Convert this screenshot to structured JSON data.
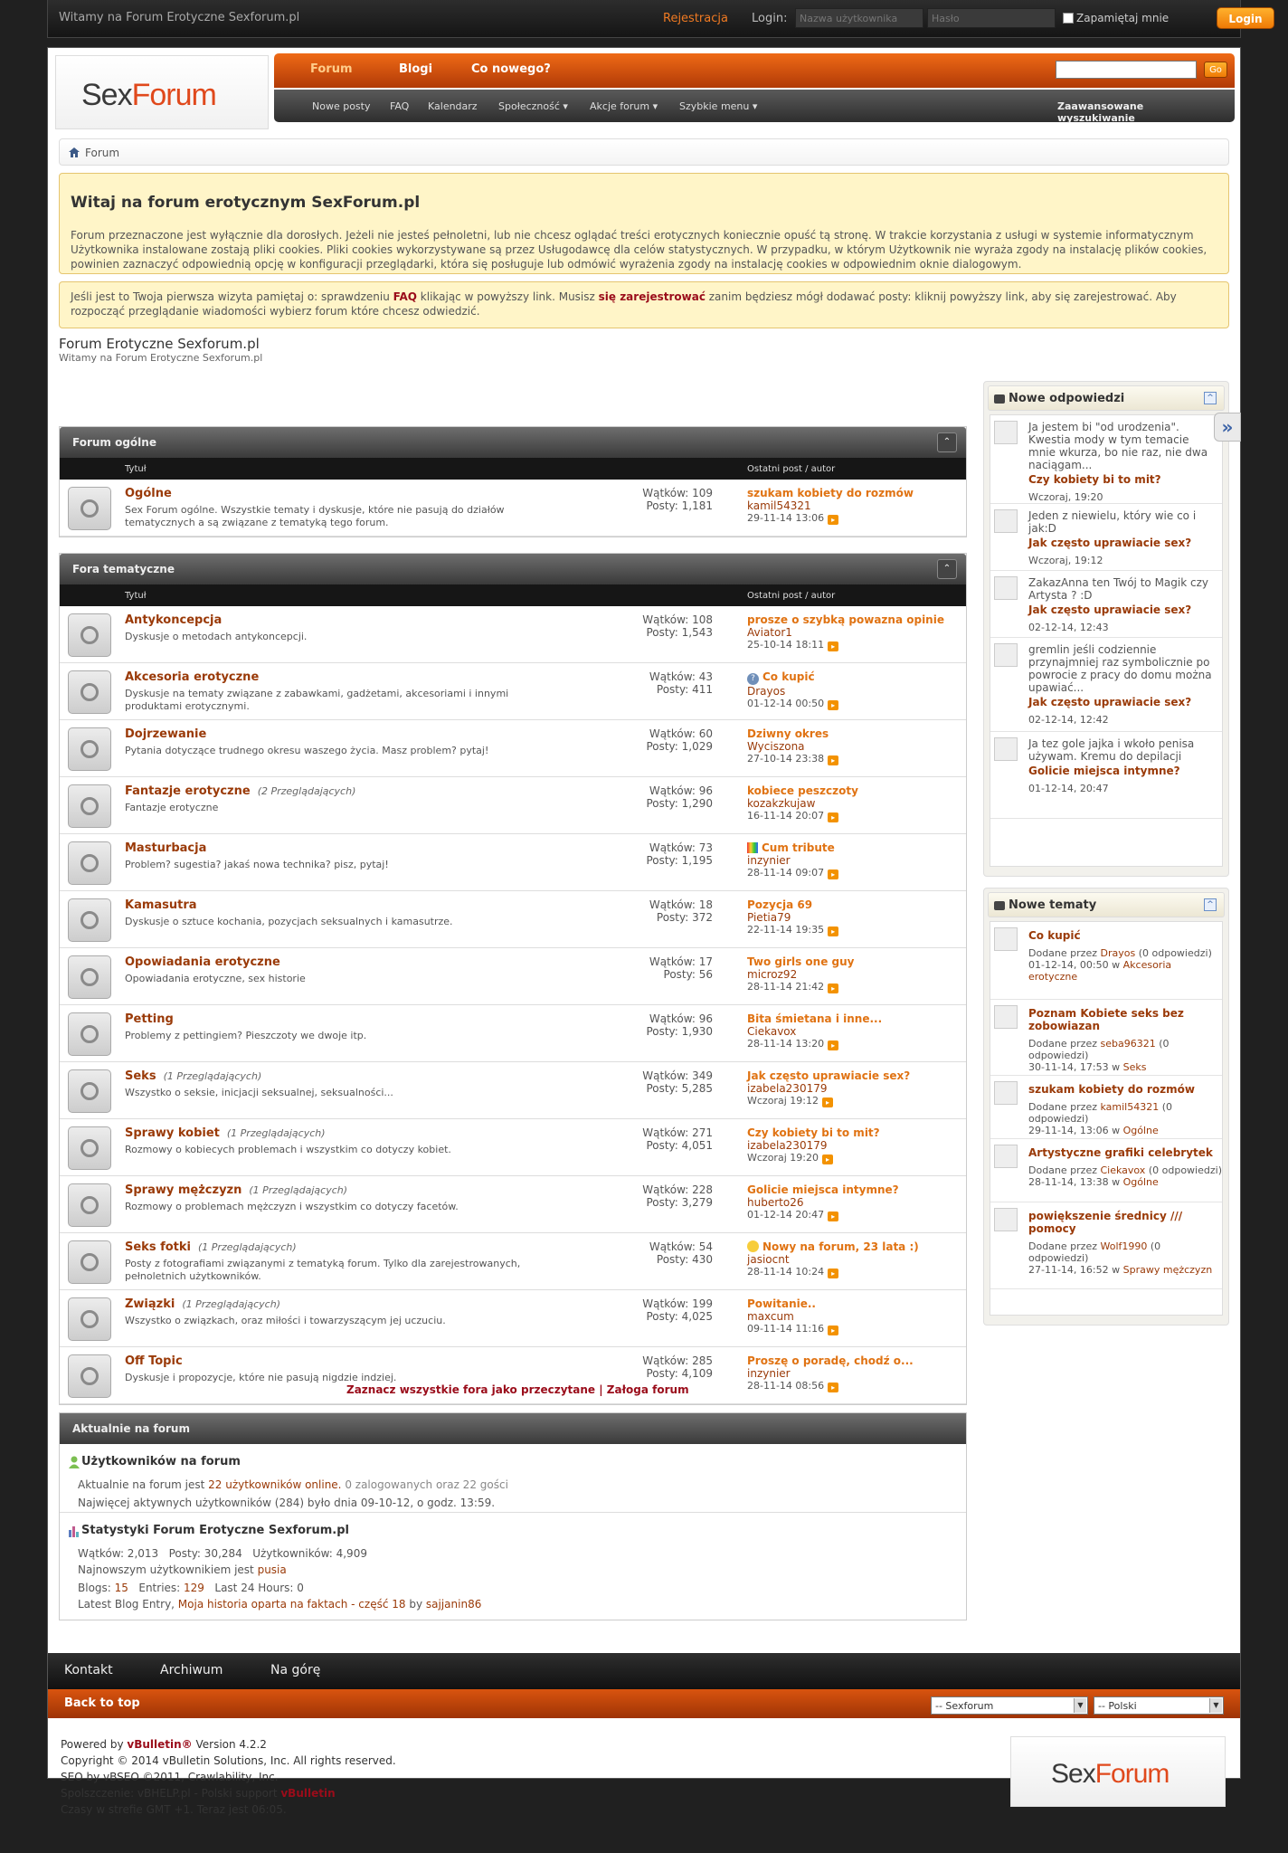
{
  "topbar": {
    "welcome": "Witamy na Forum Erotyczne Sexforum.pl",
    "register": "Rejestracja",
    "login_label": "Login:",
    "username_placeholder": "Nazwa użytkownika",
    "password_placeholder": "Hasło",
    "remember": "Zapamiętaj mnie",
    "login_button": "Login"
  },
  "logo": {
    "part1": "Sex",
    "part2": "Forum"
  },
  "nav": {
    "tabs": [
      "Forum",
      "Blogi",
      "Co nowego?"
    ],
    "go": "Go",
    "sub": [
      "Nowe posty",
      "FAQ",
      "Kalendarz",
      "Społeczność ▾",
      "Akcje forum ▾",
      "Szybkie menu ▾"
    ],
    "advanced": "Zaawansowane wyszukiwanie"
  },
  "breadcrumb": "Forum",
  "notice1": {
    "title": "Witaj na forum erotycznym SexForum.pl",
    "text": "Forum przeznaczone jest wyłącznie dla dorosłych. Jeżeli nie jesteś pełnoletni, lub nie chcesz oglądać treści erotycznych koniecznie opuść tą stronę. W trakcie korzystania z usługi w systemie informatycznym Użytkownika instalowane zostają pliki cookies. Pliki cookies wykorzystywane są przez Usługodawcę dla celów statystycznych. W przypadku, w którym Użytkownik nie wyraża zgody na instalację plików cookies, powinien zaznaczyć odpowiednią opcję w konfiguracji przeglądarki, która się posługuje lub odmówić wyrażenia zgody na instalację cookies w odpowiednim oknie dialogowym."
  },
  "notice2": {
    "t1": "Jeśli jest to Twoja pierwsza wizyta pamiętaj o: sprawdzeniu ",
    "faq": "FAQ",
    "t2": " klikając w powyższy link. Musisz ",
    "reg": "się zarejestrować",
    "t3": " zanim będziesz mógł dodawać posty: kliknij powyższy link, aby się zarejestrować. Aby rozpocząć przeglądanie wiadomości wybierz forum które chcesz odwiedzić."
  },
  "site": {
    "title": "Forum Erotyczne Sexforum.pl",
    "subtitle": "Witamy na Forum Erotyczne Sexforum.pl"
  },
  "columns": {
    "title": "Tytuł",
    "last": "Ostatni post / autor"
  },
  "blocks": [
    {
      "name": "Forum ogólne",
      "forums": [
        {
          "title": "Ogólne",
          "viewers": "",
          "desc": "Sex Forum ogólne. Wszystkie tematy i dyskusje, które nie pasują do działów tematycznych a są związane z tematyką tego forum.",
          "threads": "Wątków: 109",
          "posts": "Posty: 1,181",
          "last": "szukam kobiety do rozmów",
          "user": "kamil54321",
          "date": "29-11-14 13:06",
          "icon": ""
        }
      ]
    },
    {
      "name": "Fora tematyczne",
      "forums": [
        {
          "title": "Antykoncepcja",
          "viewers": "",
          "desc": "Dyskusje o metodach antykoncepcji.",
          "threads": "Wątków: 108",
          "posts": "Posty: 1,543",
          "last": "prosze o szybką powazna opinie",
          "user": "Aviator1",
          "date": "25-10-14 18:11",
          "icon": ""
        },
        {
          "title": "Akcesoria erotyczne",
          "viewers": "",
          "desc": "Dyskusje na tematy związane z zabawkami, gadżetami, akcesoriami i innymi produktami erotycznymi.",
          "threads": "Wątków: 43",
          "posts": "Posty: 411",
          "last": "Co kupić",
          "user": "Drayos",
          "date": "01-12-14 00:50",
          "icon": "q"
        },
        {
          "title": "Dojrzewanie",
          "viewers": "",
          "desc": "Pytania dotyczące trudnego okresu waszego życia. Masz problem? pytaj!",
          "threads": "Wątków: 60",
          "posts": "Posty: 1,029",
          "last": "Dziwny okres",
          "user": "Wyciszona",
          "date": "27-10-14 23:38",
          "icon": ""
        },
        {
          "title": "Fantazje erotyczne",
          "viewers": "(2 Przeglądających)",
          "desc": "Fantazje erotyczne",
          "threads": "Wątków: 96",
          "posts": "Posty: 1,290",
          "last": "kobiece peszczoty",
          "user": "kozakzkujaw",
          "date": "16-11-14 20:07",
          "icon": ""
        },
        {
          "title": "Masturbacja",
          "viewers": "",
          "desc": "Problem? sugestia? jakaś nowa technika? pisz, pytaj!",
          "threads": "Wątków: 73",
          "posts": "Posty: 1,195",
          "last": "Cum tribute",
          "user": "inzynier",
          "date": "28-11-14 09:07",
          "icon": "p"
        },
        {
          "title": "Kamasutra",
          "viewers": "",
          "desc": "Dyskusje o sztuce kochania, pozycjach seksualnych i kamasutrze.",
          "threads": "Wątków: 18",
          "posts": "Posty: 372",
          "last": "Pozycja 69",
          "user": "Pietia79",
          "date": "22-11-14 19:35",
          "icon": ""
        },
        {
          "title": "Opowiadania erotyczne",
          "viewers": "",
          "desc": "Opowiadania erotyczne, sex historie",
          "threads": "Wątków: 17",
          "posts": "Posty: 56",
          "last": "Two girls one guy",
          "user": "microz92",
          "date": "28-11-14 21:42",
          "icon": ""
        },
        {
          "title": "Petting",
          "viewers": "",
          "desc": "Problemy z pettingiem? Pieszczoty we dwoje itp.",
          "threads": "Wątków: 96",
          "posts": "Posty: 1,930",
          "last": "Bita śmietana i inne...",
          "user": "Ciekavox",
          "date": "28-11-14 13:20",
          "icon": ""
        },
        {
          "title": "Seks",
          "viewers": "(1 Przeglądających)",
          "desc": "Wszystko o seksie, inicjacji seksualnej, seksualności...",
          "threads": "Wątków: 349",
          "posts": "Posty: 5,285",
          "last": "Jak często uprawiacie sex?",
          "user": "izabela230179",
          "date": "Wczoraj 19:12",
          "icon": ""
        },
        {
          "title": "Sprawy kobiet",
          "viewers": "(1 Przeglądających)",
          "desc": "Rozmowy o kobiecych problemach i wszystkim co dotyczy kobiet.",
          "threads": "Wątków: 271",
          "posts": "Posty: 4,051",
          "last": "Czy kobiety bi to mit?",
          "user": "izabela230179",
          "date": "Wczoraj 19:20",
          "icon": ""
        },
        {
          "title": "Sprawy mężczyzn",
          "viewers": "(1 Przeglądających)",
          "desc": "Rozmowy o problemach mężczyzn i wszystkim co dotyczy facetów.",
          "threads": "Wątków: 228",
          "posts": "Posty: 3,279",
          "last": "Golicie miejsca intymne?",
          "user": "huberto26",
          "date": "01-12-14 20:47",
          "icon": ""
        },
        {
          "title": "Seks fotki",
          "viewers": "(1 Przeglądających)",
          "desc": "Posty z fotografiami związanymi z tematyką forum. Tylko dla zarejestrowanych, pełnoletnich użytkowników.",
          "threads": "Wątków: 54",
          "posts": "Posty: 430",
          "last": "Nowy na forum, 23 lata :)",
          "user": "jasiocnt",
          "date": "28-11-14 10:24",
          "icon": "e"
        },
        {
          "title": "Związki",
          "viewers": "(1 Przeglądających)",
          "desc": "Wszystko o związkach, oraz miłości i towarzyszącym jej uczuciu.",
          "threads": "Wątków: 199",
          "posts": "Posty: 4,025",
          "last": "Powitanie..",
          "user": "maxcum",
          "date": "09-11-14 11:16",
          "icon": ""
        },
        {
          "title": "Off Topic",
          "viewers": "",
          "desc": "Dyskusje i propozycje, które nie pasują nigdzie indziej.",
          "threads": "Wątków: 285",
          "posts": "Posty: 4,109",
          "last": "Proszę o poradę, chodź o...",
          "user": "inzynier",
          "date": "28-11-14 08:56",
          "icon": ""
        }
      ]
    }
  ],
  "markall": {
    "a": "Zaznacz wszystkie fora jako przeczytane",
    "sep": " | ",
    "b": "Załoga forum"
  },
  "online": {
    "header": "Aktualnie na forum",
    "users_title": "Użytkowników na forum",
    "l1a": "Aktualnie na forum jest ",
    "l1b": "22 użytkowników online.",
    "l1c": " 0 zalogowanych oraz 22 gości",
    "l2": "Najwięcej aktywnych użytkowników (284) było dnia 09-10-12, o godz. 13:59.",
    "stats_title": "Statystyki Forum Erotyczne Sexforum.pl",
    "s1": "Wątków: 2,013   Posty: 30,284   Użytkowników: 4,909",
    "s2a": "Najnowszym użytkownikiem jest ",
    "s2b": "pusia",
    "s3a": "Blogs: ",
    "s3b": "15",
    "s3c": "   Entries: ",
    "s3d": "129",
    "s3e": "   Last 24 Hours: 0",
    "s4a": "Latest Blog Entry, ",
    "s4b": "Moja historia oparta na faktach - część 18",
    "s4c": " by ",
    "s4d": "sajjanin86"
  },
  "sidebar": {
    "replies_title": "Nowe odpowiedzi",
    "replies": [
      {
        "text": "Ja jestem bi \"od urodzenia\". Kwestia mody w tym temacie mnie wkurza, bo nie raz, nie dwa naciągam...",
        "title": "Czy kobiety bi to mit?",
        "date": "Wczoraj, 19:20"
      },
      {
        "text": "Jeden z niewielu, który wie co i jak:D",
        "title": "Jak często uprawiacie sex?",
        "date": "Wczoraj, 19:12"
      },
      {
        "text": "ZakazAnna ten Twój to Magik czy Artysta ? :D",
        "title": "Jak często uprawiacie sex?",
        "date": "02-12-14, 12:43"
      },
      {
        "text": "gremlin jeśli codziennie przynajmniej raz symbolicznie po powrocie z pracy do domu można upawiać...",
        "title": "Jak często uprawiacie sex?",
        "date": "02-12-14, 12:42"
      },
      {
        "text": "Ja tez gole jajka i wkoło penisa używam. Kremu do depilacji",
        "title": "Golicie miejsca intymne?",
        "date": "01-12-14, 20:47"
      }
    ],
    "topics_title": "Nowe tematy",
    "topics": [
      {
        "title": "Co kupić",
        "by": "Drayos",
        "replies": "0",
        "date": "01-12-14, 00:50",
        "forum": "Akcesoria erotyczne"
      },
      {
        "title": "Poznam Kobiete seks bez zobowiazan",
        "by": "seba96321",
        "replies": "0",
        "date": "30-11-14, 17:53",
        "forum": "Seks"
      },
      {
        "title": "szukam kobiety do rozmów",
        "by": "kamil54321",
        "replies": "0",
        "date": "29-11-14, 13:06",
        "forum": "Ogólne"
      },
      {
        "title": "Artystyczne grafiki celebrytek",
        "by": "Ciekavox",
        "replies": "0",
        "date": "28-11-14, 13:38",
        "forum": "Ogólne"
      },
      {
        "title": "powiększenie średnicy /// pomocy",
        "by": "Wolf1990",
        "replies": "0",
        "date": "27-11-14, 16:52",
        "forum": "Sprawy mężczyzn"
      }
    ],
    "added_by": "Dodane przez ",
    "replies_word": "odpowiedzi",
    "in_word": " w "
  },
  "footer": {
    "links": [
      "Kontakt",
      "Archiwum",
      "Na górę"
    ],
    "back": "Back to top",
    "select1": "-- Sexforum",
    "select2": "-- Polski",
    "p1a": "Powered by ",
    "p1b": "vBulletin®",
    "p1c": " Version 4.2.2",
    "p2": "Copyright © 2014 vBulletin Solutions, Inc. All rights reserved.",
    "p3": "SEO by vBSEO ©2011, Crawlability, Inc.",
    "p4a": "Spolszczenie: vBHELP.pl - Polski support ",
    "p4b": "vBulletin",
    "p5": "Czasy w strefie GMT +1. Teraz jest 06:05."
  }
}
